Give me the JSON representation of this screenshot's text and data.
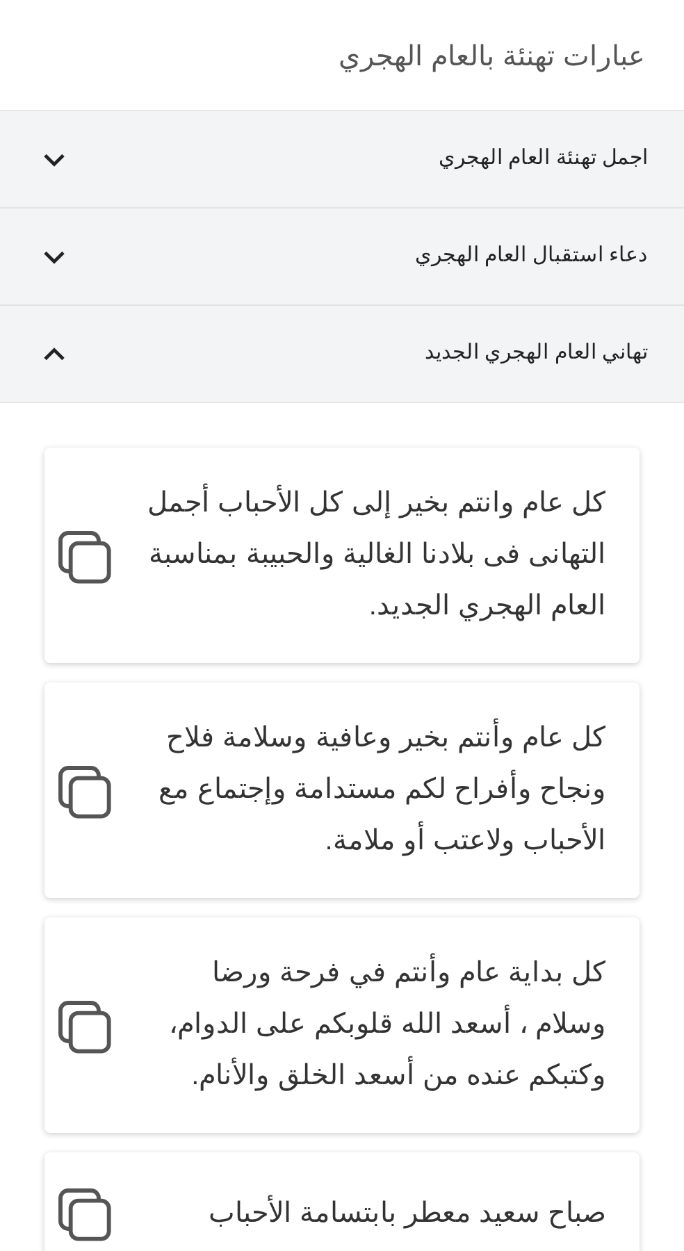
{
  "header": {
    "title": "عبارات تهنئة بالعام الهجري"
  },
  "sections": [
    {
      "title": "اجمل تهنئة العام الهجري",
      "expanded": false
    },
    {
      "title": "دعاء استقبال العام الهجري",
      "expanded": false
    },
    {
      "title": "تهاني العام الهجري الجديد",
      "expanded": true,
      "cards": [
        {
          "text": "كل عام وانتم بخير إلى كل الأحباب أجمل التهانى فى بلادنا الغالية والحبيبة بمناسبة العام الهجري الجديد."
        },
        {
          "text": "كل عام وأنتم بخير وعافية وسلامة فلاح ونجاح وأفراح لكم مستدامة وإجتماع مع الأحباب ولاعتب أو ملامة."
        },
        {
          "text": "كل بداية عام وأنتم في فرحة ورضا وسلام ، أسعد الله قلوبكم على الدوام، وكتبكم عنده من أسعد الخلق والأنام."
        },
        {
          "text": "صباح سعيد معطر بابتسامة الأحباب"
        }
      ]
    }
  ]
}
